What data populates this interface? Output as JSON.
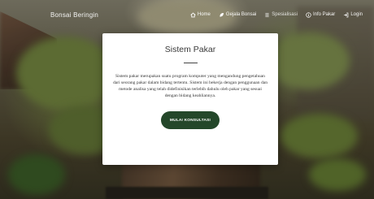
{
  "navbar": {
    "brand": "Bonsai Beringin",
    "links": [
      {
        "label": "Home",
        "icon": "home-icon"
      },
      {
        "label": "Gejala Bonsai",
        "icon": "leaf-icon"
      },
      {
        "label": "Spesialisasi",
        "icon": "list-icon"
      },
      {
        "label": "Info Pakar",
        "icon": "info-icon"
      },
      {
        "label": "Login",
        "icon": "login-icon"
      }
    ]
  },
  "card": {
    "title": "Sistem Pakar",
    "description": "Sistem pakar merupakan suatu program komputer yang mengandung pengetahuan dari seorang pakar dalam bidang tertentu. Sistem ini bekerja dengan penggunaan dan metode analisa yang telah didefinisikan terlebih dahulu oleh pakar yang sesuai dengan bidang keahliannya.",
    "button_label": "MULAI KONSULTASI"
  },
  "colors": {
    "accent": "#24472a",
    "card_bg": "#ffffff"
  }
}
